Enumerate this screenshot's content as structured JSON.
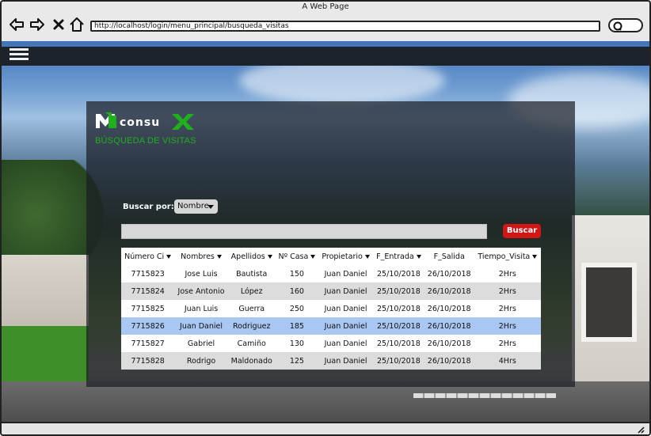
{
  "window": {
    "title": "A Web Page",
    "url": "http://localhost/login/menu_principal/busqueda_visitas"
  },
  "brand": {
    "logo_text": "consulX",
    "section_title": "BÚSQUEDA DE VISITAS",
    "accent_color": "#1fb11b"
  },
  "search": {
    "label": "Buscar por:",
    "filter_selected": "Nombre",
    "input_value": "",
    "button_label": "Buscar",
    "button_color": "#d21616"
  },
  "table": {
    "columns": [
      "Número Ci",
      "Nombres",
      "Apellidos",
      "Nº Casa",
      "Propietario",
      "F_Entrada",
      "F_Salida",
      "Tiempo_Visita"
    ],
    "rows": [
      [
        "7715823",
        "Jose Luis",
        "Bautista",
        "150",
        "Juan Daniel",
        "25/10/2018",
        "26/10/2018",
        "2Hrs"
      ],
      [
        "7715824",
        "Jose Antonio",
        "López",
        "160",
        "Juan Daniel",
        "25/10/2018",
        "26/10/2018",
        "2Hrs"
      ],
      [
        "7715825",
        "Juan Luis",
        "Guerra",
        "250",
        "Juan Daniel",
        "25/10/2018",
        "26/10/2018",
        "2Hrs"
      ],
      [
        "7715826",
        "Juan Daniel",
        "Rodriguez",
        "185",
        "Juan Daniel",
        "25/10/2018",
        "26/10/2018",
        "2Hrs"
      ],
      [
        "7715827",
        "Gabriel",
        "Camiño",
        "130",
        "Juan Daniel",
        "25/10/2018",
        "26/10/2018",
        "2Hrs"
      ],
      [
        "7715828",
        "Rodrigo",
        "Maldonado",
        "125",
        "Juan Daniel",
        "25/10/2018",
        "26/10/2018",
        "4Hrs"
      ]
    ],
    "selected_row": 3,
    "selected_color": "#a8c7f2"
  }
}
